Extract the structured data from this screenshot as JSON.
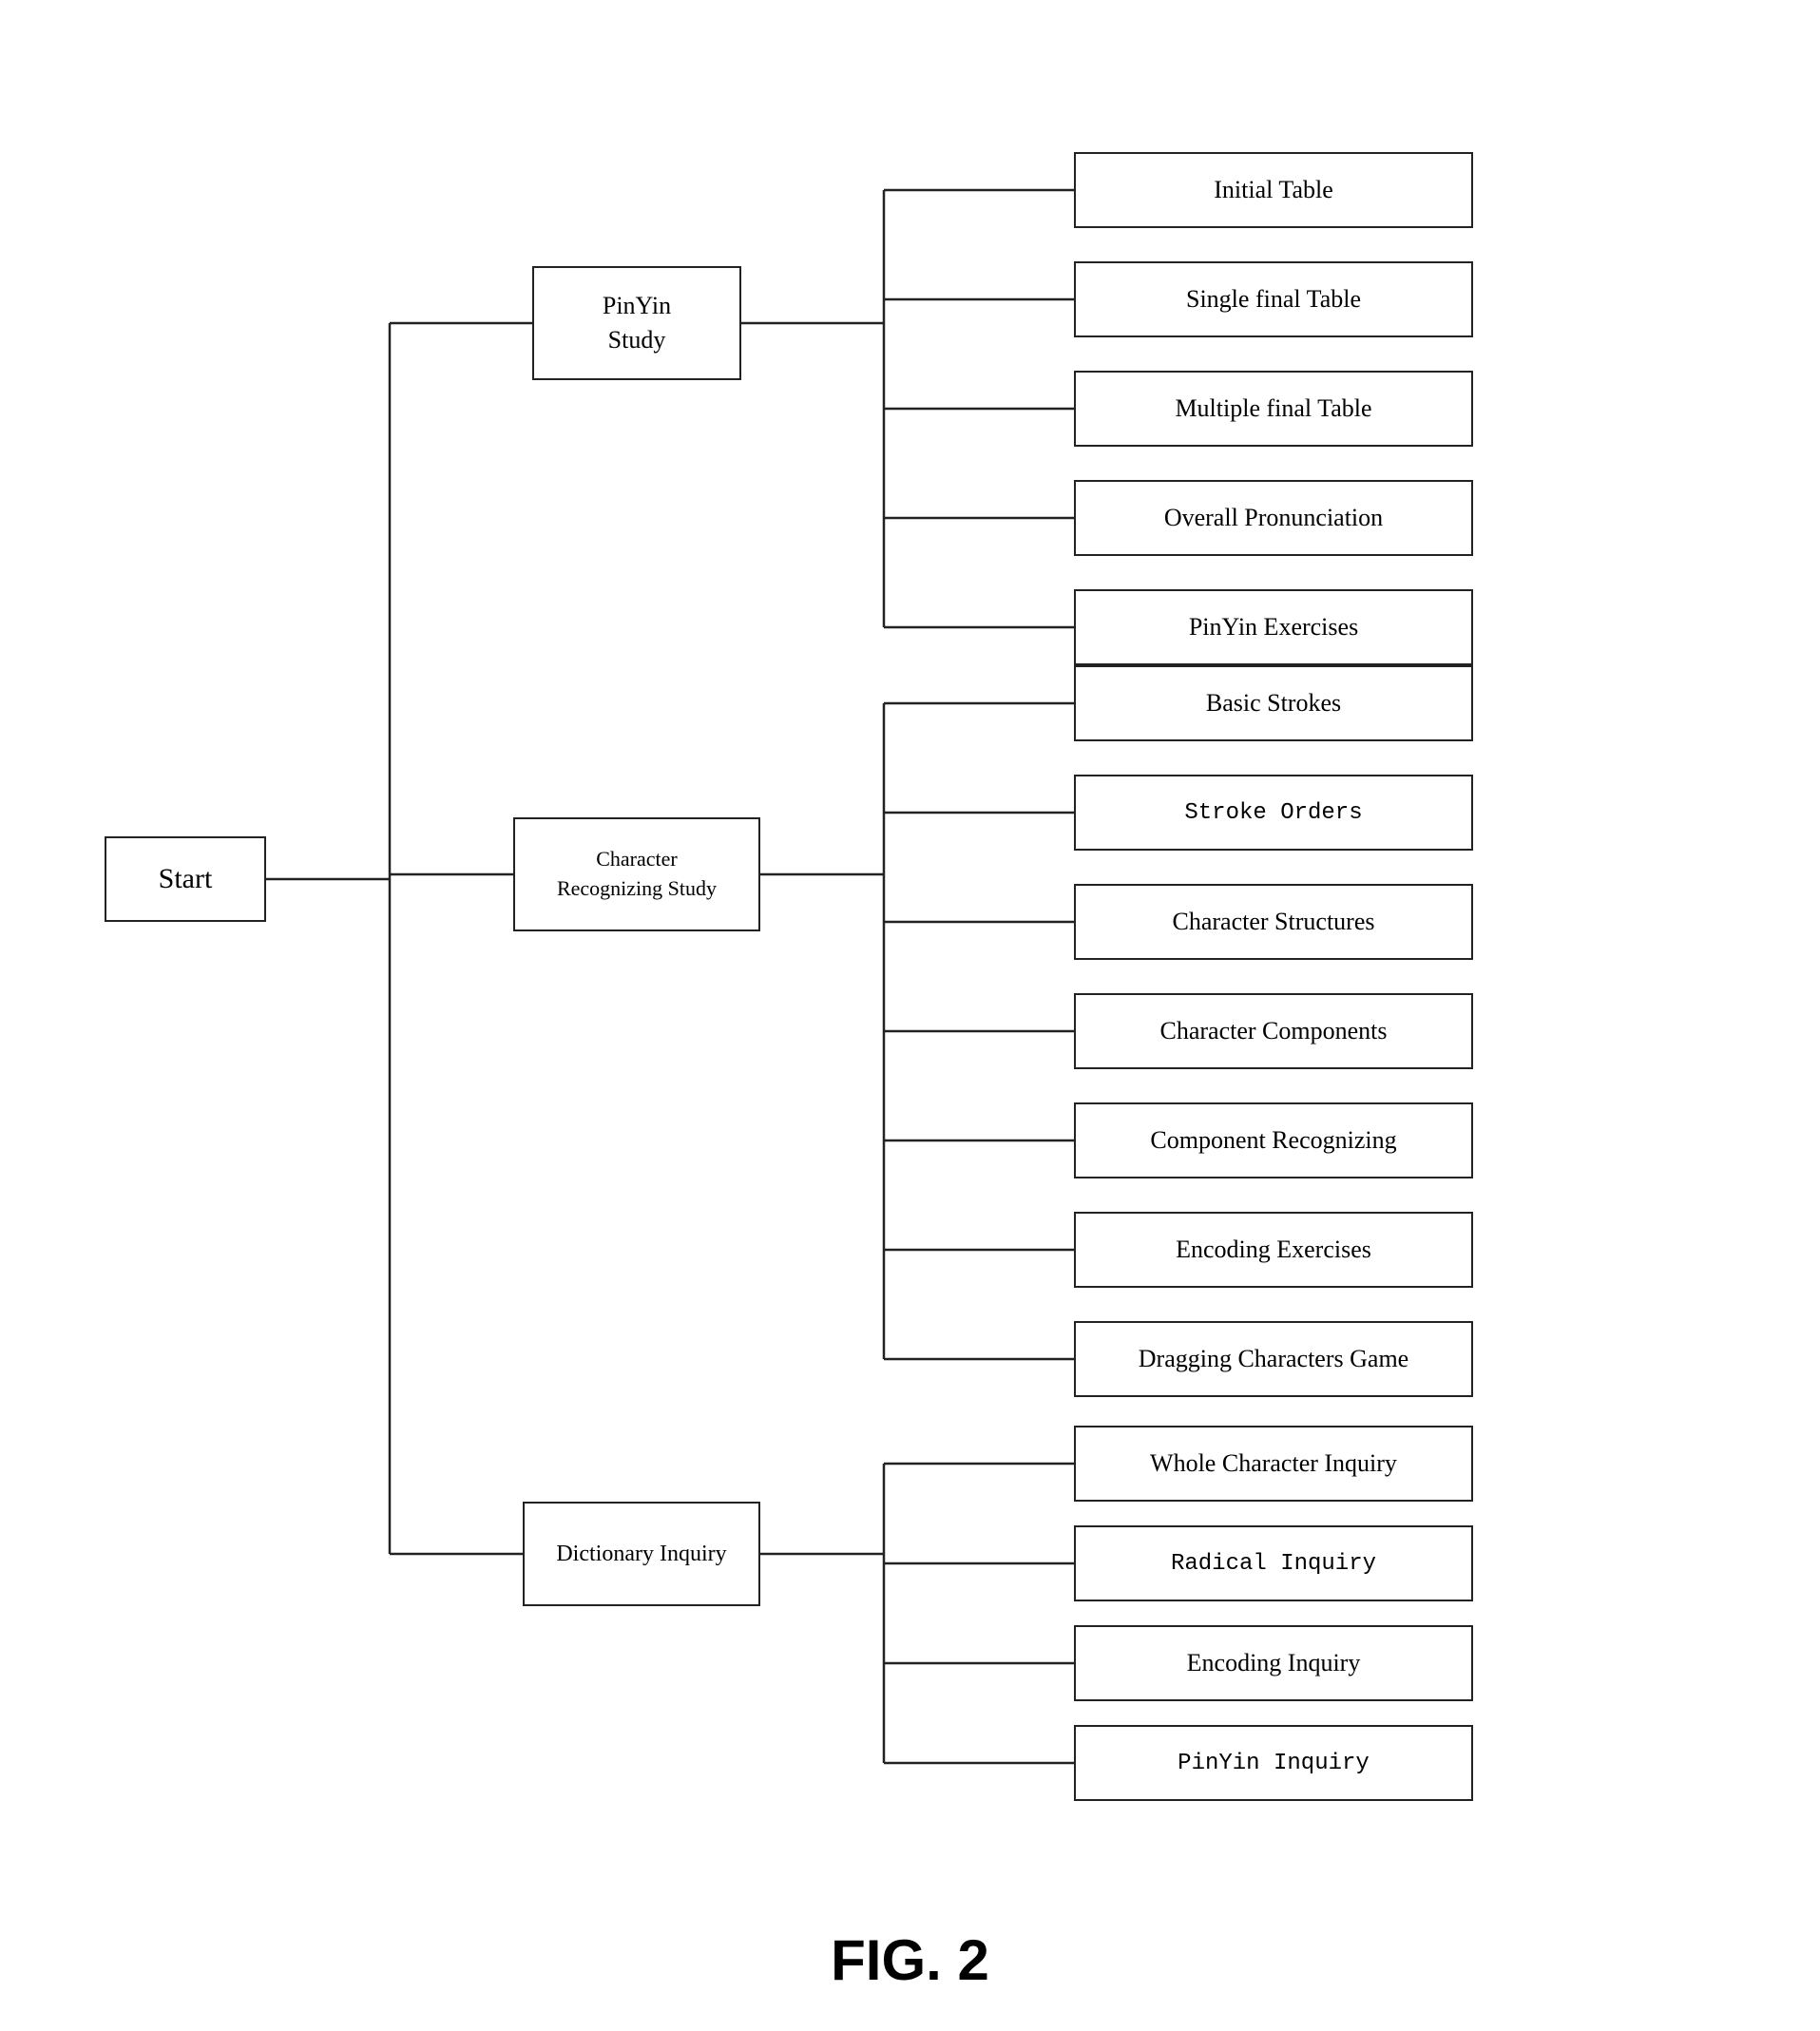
{
  "diagram": {
    "title": "FIG. 2",
    "nodes": {
      "start": "Start",
      "pinyin": "PinYin\nStudy",
      "character": "Character\nRecognizing Study",
      "dictionary": "Dictionary Inquiry"
    },
    "pinyin_children": [
      "Initial Table",
      "Single final Table",
      "Multiple final Table",
      "Overall Pronunciation",
      "PinYin Exercises"
    ],
    "character_children": [
      "Basic Strokes",
      "Stroke Orders",
      "Character Structures",
      "Character Components",
      "Component Recognizing",
      "Encoding Exercises",
      "Dragging Characters Game"
    ],
    "dictionary_children": [
      "Whole Character Inquiry",
      "Radical Inquiry",
      "Encoding Inquiry",
      "PinYin Inquiry"
    ]
  }
}
